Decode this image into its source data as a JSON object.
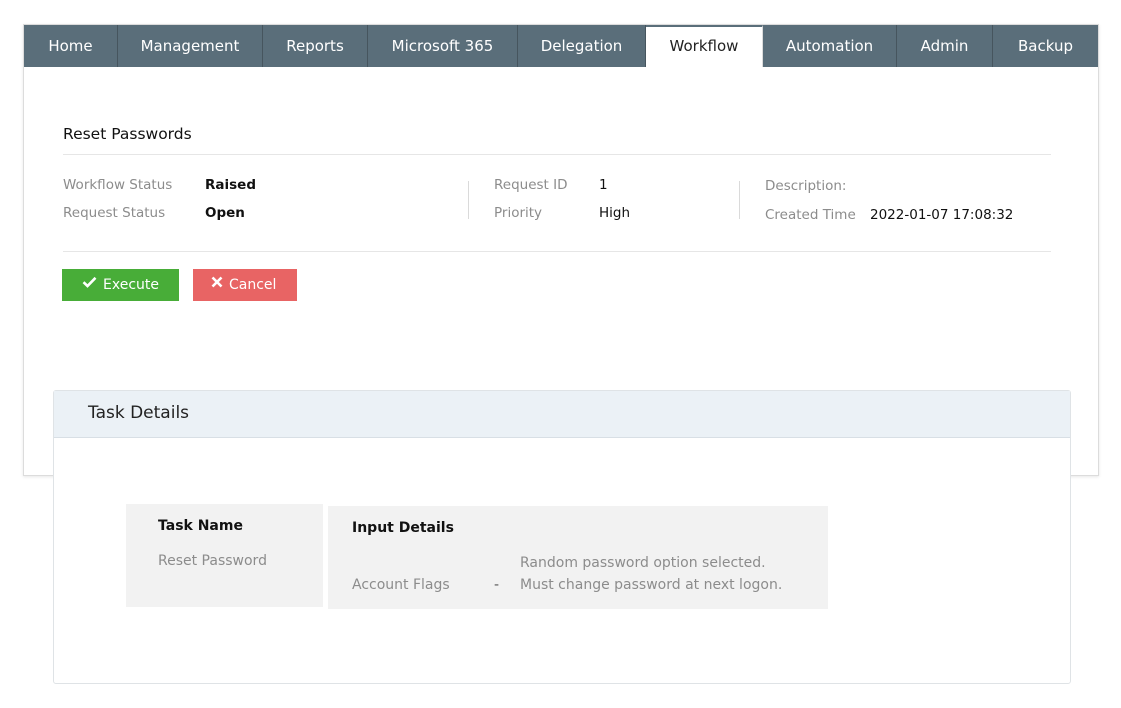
{
  "tabs": [
    "Home",
    "Management",
    "Reports",
    "Microsoft 365",
    "Delegation",
    "Workflow",
    "Automation",
    "Admin",
    "Backup"
  ],
  "active_tab": "Workflow",
  "request": {
    "title": "Reset Passwords",
    "workflow_status_label": "Workflow Status",
    "workflow_status_value": "Raised",
    "request_status_label": "Request Status",
    "request_status_value": "Open",
    "request_id_label": "Request ID",
    "request_id_value": "1",
    "priority_label": "Priority",
    "priority_value": "High",
    "description_label": "Description:",
    "created_time_label": "Created Time",
    "created_time_value": "2022-01-07 17:08:32"
  },
  "actions": {
    "execute_label": "Execute",
    "cancel_label": "Cancel"
  },
  "task_details": {
    "title": "Task Details",
    "task_name_header": "Task Name",
    "task_name_value": "Reset Password",
    "input_details_header": "Input Details",
    "field_label": "Account Flags",
    "separator": "-",
    "flag_lines": [
      "Random password option selected.",
      "Must change password at next logon."
    ]
  },
  "colors": {
    "tab_bar": "#5a6e7a",
    "execute": "#48ad38",
    "cancel": "#e86464",
    "panel_header": "#ebf1f6"
  }
}
